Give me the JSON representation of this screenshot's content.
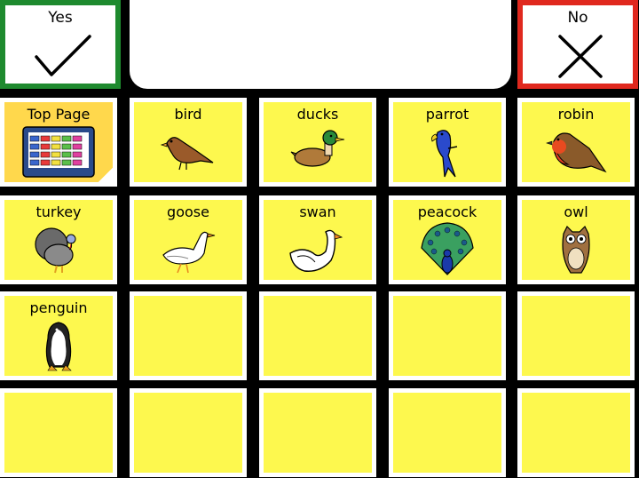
{
  "header": {
    "yes_label": "Yes",
    "no_label": "No",
    "message": ""
  },
  "grid": {
    "cells": [
      {
        "label": "Top Page",
        "icon": "keyboard-icon"
      },
      {
        "label": "bird",
        "icon": "bird-icon"
      },
      {
        "label": "ducks",
        "icon": "duck-icon"
      },
      {
        "label": "parrot",
        "icon": "parrot-icon"
      },
      {
        "label": "robin",
        "icon": "robin-icon"
      },
      {
        "label": "turkey",
        "icon": "turkey-icon"
      },
      {
        "label": "goose",
        "icon": "goose-icon"
      },
      {
        "label": "swan",
        "icon": "swan-icon"
      },
      {
        "label": "peacock",
        "icon": "peacock-icon"
      },
      {
        "label": "owl",
        "icon": "owl-icon"
      },
      {
        "label": "penguin",
        "icon": "penguin-icon"
      },
      {
        "label": ""
      },
      {
        "label": ""
      },
      {
        "label": ""
      },
      {
        "label": ""
      },
      {
        "label": ""
      },
      {
        "label": ""
      },
      {
        "label": ""
      },
      {
        "label": ""
      },
      {
        "label": ""
      }
    ]
  },
  "colors": {
    "cell": "#fdf84e",
    "yes_border": "#1e8a2e",
    "no_border": "#e0281e",
    "top_page": "#ffd84c"
  }
}
